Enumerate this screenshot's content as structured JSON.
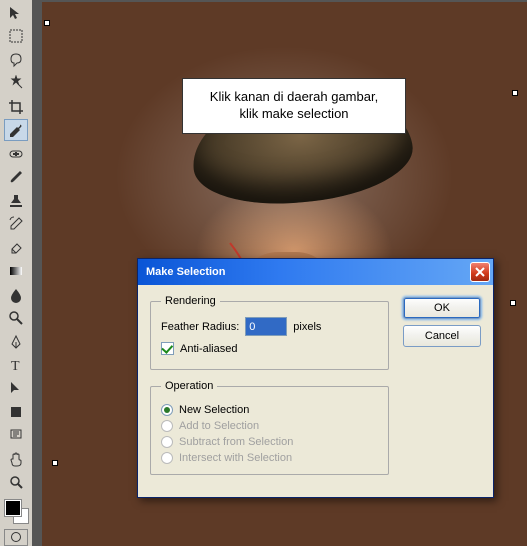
{
  "annotation": {
    "callout_line1": "Klik kanan di daerah gambar,",
    "callout_line2": "klik make selection"
  },
  "dialog": {
    "title": "Make Selection",
    "rendering": {
      "legend": "Rendering",
      "feather_label": "Feather Radius:",
      "feather_value": "0",
      "feather_unit": "pixels",
      "antialiased_label": "Anti-aliased",
      "antialiased_checked": true
    },
    "operation": {
      "legend": "Operation",
      "options": [
        {
          "label": "New Selection",
          "selected": true,
          "enabled": true
        },
        {
          "label": "Add to Selection",
          "selected": false,
          "enabled": false
        },
        {
          "label": "Subtract from Selection",
          "selected": false,
          "enabled": false
        },
        {
          "label": "Intersect with Selection",
          "selected": false,
          "enabled": false
        }
      ]
    },
    "buttons": {
      "ok": "OK",
      "cancel": "Cancel"
    }
  },
  "tools": [
    "move-tool",
    "marquee-tool",
    "lasso-tool",
    "wand-tool",
    "crop-tool",
    "eyedropper-tool",
    "healing-tool",
    "brush-tool",
    "stamp-tool",
    "history-brush-tool",
    "eraser-tool",
    "gradient-tool",
    "blur-tool",
    "dodge-tool",
    "pen-tool",
    "type-tool",
    "path-select-tool",
    "shape-tool",
    "notes-tool",
    "hand-tool",
    "zoom-tool"
  ]
}
